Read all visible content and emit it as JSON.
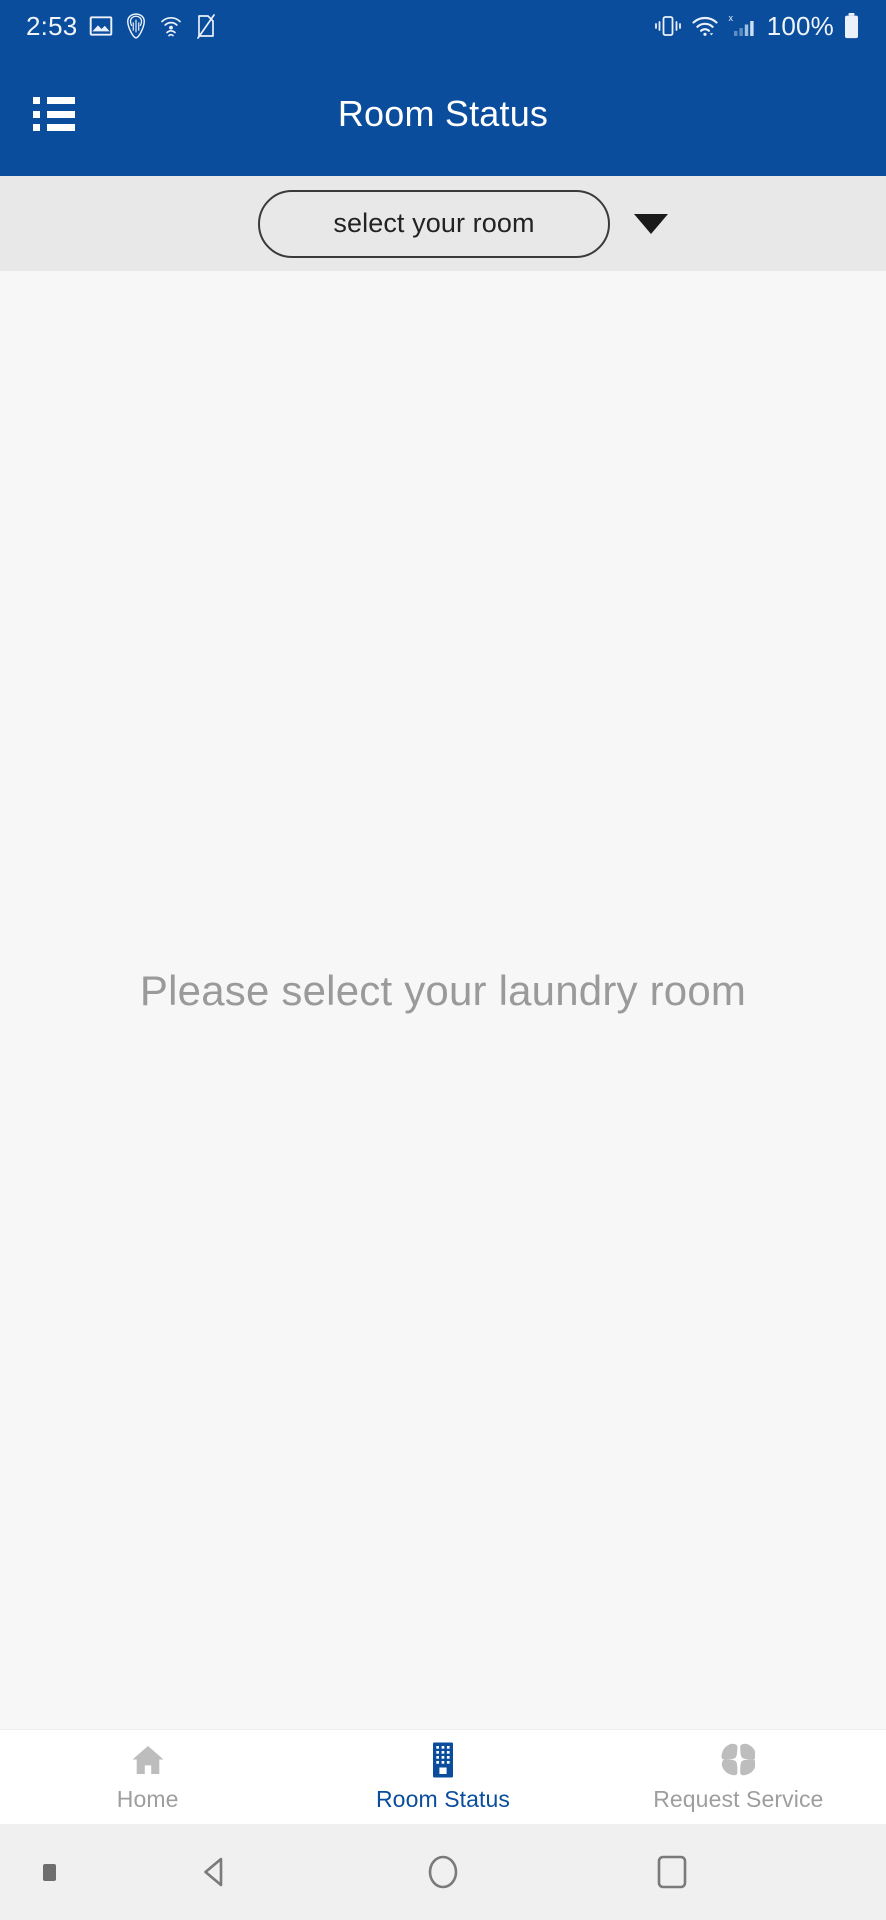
{
  "status_bar": {
    "time": "2:53",
    "battery_percent": "100%",
    "left_icons": [
      "photo-icon",
      "magisk-mask-icon",
      "wifi-calling-icon",
      "no-sim-card-icon"
    ],
    "right_icons": [
      "vibrate-mode-icon",
      "wifi-icon",
      "cellular-signal-no-service-icon",
      "battery-full-icon"
    ],
    "background_color": "#0A4D9C",
    "text_color": "#EFF4FB"
  },
  "app_bar": {
    "title": "Room Status",
    "menu_icon": "list-menu-icon",
    "background_color": "#0A4D9C",
    "title_color": "#FFFFFF"
  },
  "selector": {
    "room_value": "select your room",
    "room_placeholder": "select your room",
    "dropdown_icon": "caret-down-icon",
    "strip_background": "#E8E8E8",
    "border_color": "#3A3A3A"
  },
  "content": {
    "empty_message": "Please select your laundry room",
    "background_color": "#F7F7F7",
    "text_color": "#9A9A9A"
  },
  "tab_bar": {
    "background_color": "#FFFFFF",
    "active_color": "#0A4D9C",
    "inactive_color": "#9E9E9E",
    "tabs": [
      {
        "label": "Home",
        "icon": "home-icon",
        "active": false
      },
      {
        "label": "Room Status",
        "icon": "building-icon",
        "active": true
      },
      {
        "label": "Request Service",
        "icon": "clover-grid-icon",
        "active": false
      }
    ]
  },
  "system_nav": {
    "background_color": "#F0F0F0",
    "icon_color": "#6E6E6E",
    "buttons": [
      "back-button",
      "home-button",
      "recents-button"
    ]
  }
}
